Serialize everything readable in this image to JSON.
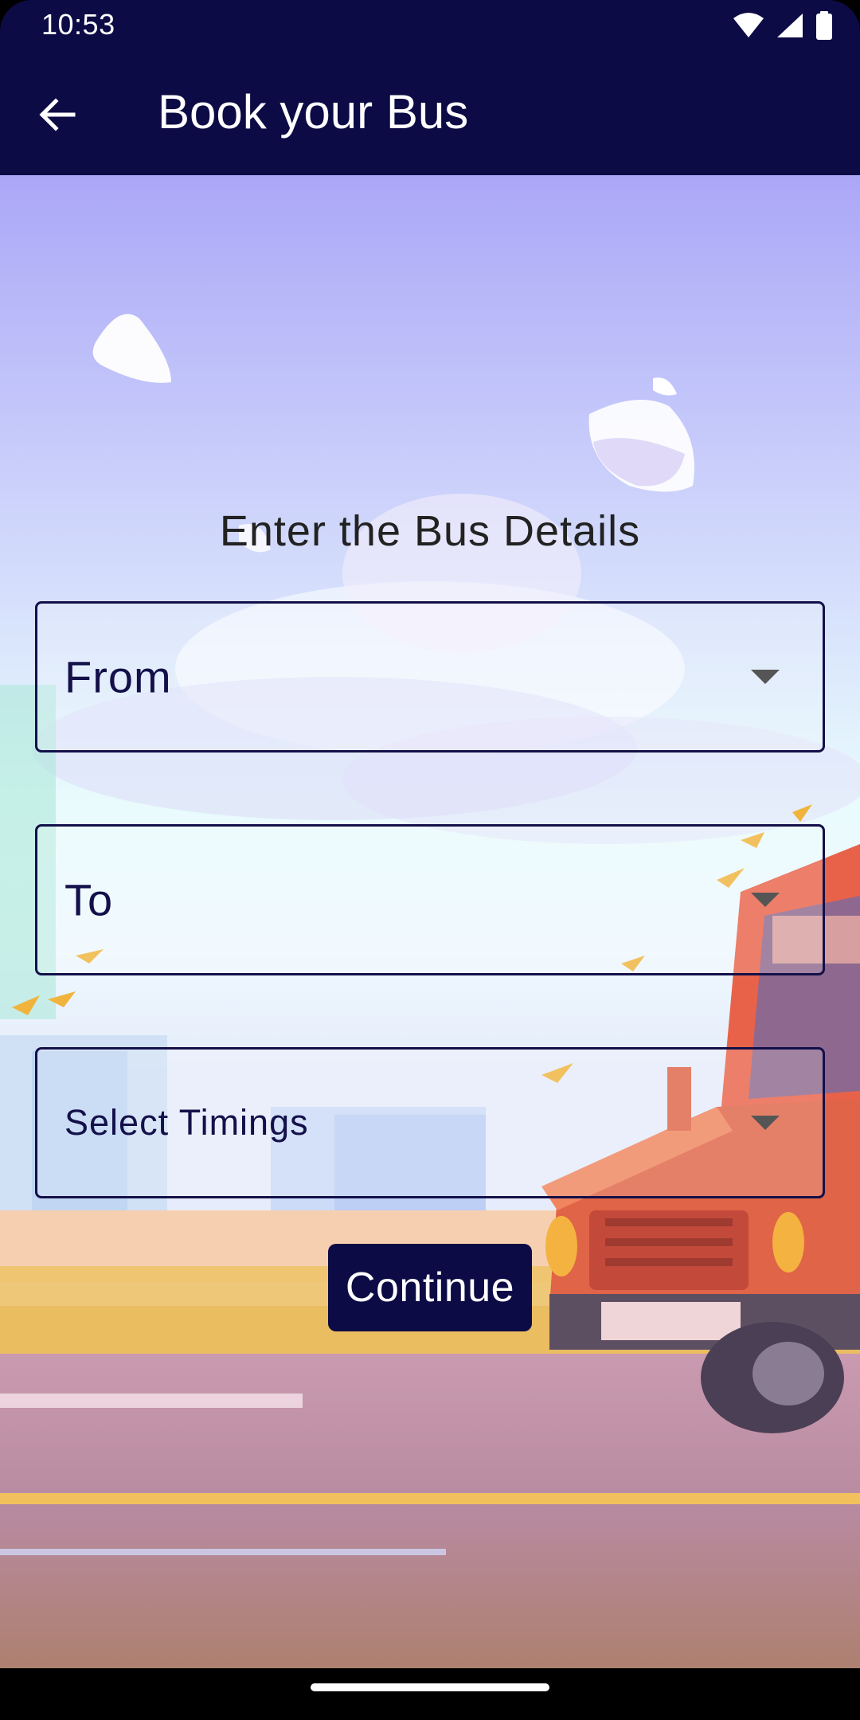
{
  "status_bar": {
    "time": "10:53",
    "icons": [
      "wifi-icon",
      "signal-icon",
      "battery-icon"
    ]
  },
  "app_bar": {
    "back_icon": "arrow-left-icon",
    "title": "Book your Bus"
  },
  "form": {
    "heading": "Enter the Bus Details",
    "from_label": "From",
    "to_label": "To",
    "timings_label": "Select Timings",
    "continue_label": "Continue"
  },
  "colors": {
    "primary": "#0d0b45",
    "field_border": "#13104a",
    "heading_text": "#222222",
    "on_primary": "#ffffff"
  }
}
